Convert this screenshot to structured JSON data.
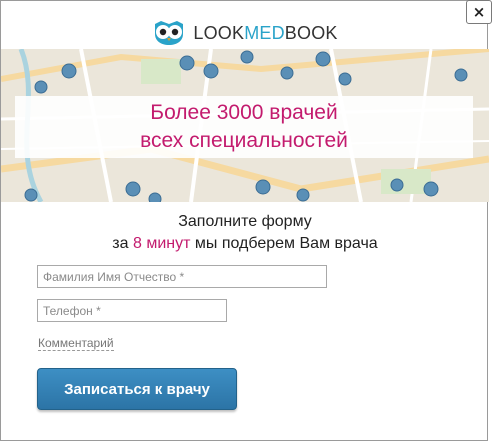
{
  "logo": {
    "part1": "LOOK",
    "part2": "MED",
    "part3": "BOOK",
    "icon": "owl-icon"
  },
  "close_label": "×",
  "banner": {
    "line1": "Более 3000 врачей",
    "line2": "всех специальностей"
  },
  "subtitle": {
    "line1": "Заполните форму",
    "line2_before": "за ",
    "line2_highlight": "8 минут",
    "line2_after": " мы подберем Вам врача"
  },
  "form": {
    "name_placeholder": "Фамилия Имя Отчество *",
    "phone_placeholder": "Телефон *",
    "comment_link": "Комментарий",
    "submit_label": "Записаться к врачу"
  },
  "colors": {
    "accent": "#c31b6e",
    "brand": "#2aa3c9",
    "button": "#2c74a6"
  }
}
